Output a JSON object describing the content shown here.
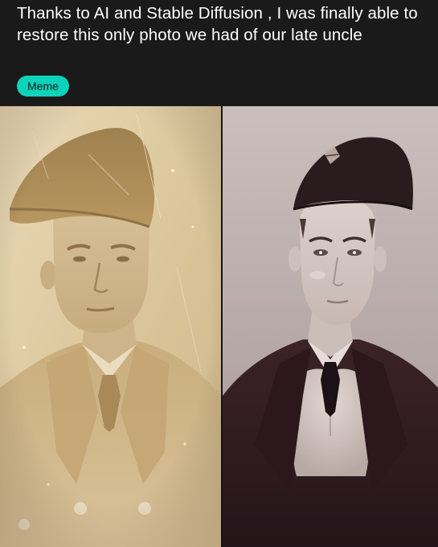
{
  "post": {
    "title": "Thanks to AI and Stable Diffusion , I was finally able to restore this only photo we had of our late uncle",
    "flair": "Meme"
  },
  "colors": {
    "background": "#1a1a1b",
    "flair_background": "#0dd3bb",
    "flair_text": "#1a1a1b",
    "title_text": "#ffffff"
  }
}
